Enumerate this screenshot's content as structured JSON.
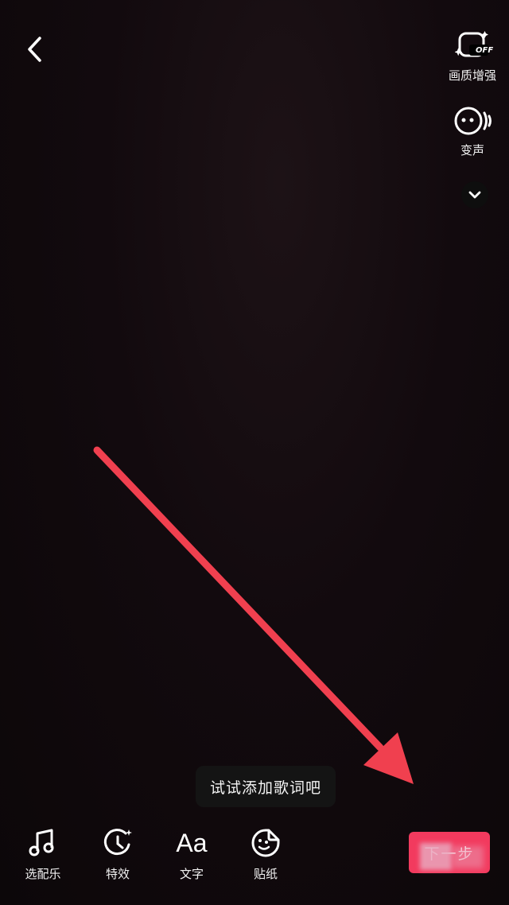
{
  "top_left": {
    "back_icon": "chevron-left-icon"
  },
  "side_tools": [
    {
      "label": "画质增强",
      "icon": "quality-enhance-off-icon",
      "badge": "OFF"
    },
    {
      "label": "变声",
      "icon": "voice-change-icon"
    }
  ],
  "collapse_icon": "chevron-down-icon",
  "hint": {
    "text": "试试添加歌词吧"
  },
  "bottom_tools": [
    {
      "label": "选配乐",
      "icon": "music-note-icon"
    },
    {
      "label": "特效",
      "icon": "effects-clock-icon"
    },
    {
      "label": "文字",
      "icon": "text-aa-icon",
      "glyph": "Aa"
    },
    {
      "label": "贴纸",
      "icon": "sticker-icon"
    }
  ],
  "next_button": {
    "label": "下一步"
  },
  "annotation": {
    "arrow_color": "#f0404f"
  },
  "colors": {
    "background": "#120a0e",
    "accent": "#f23a5e"
  }
}
